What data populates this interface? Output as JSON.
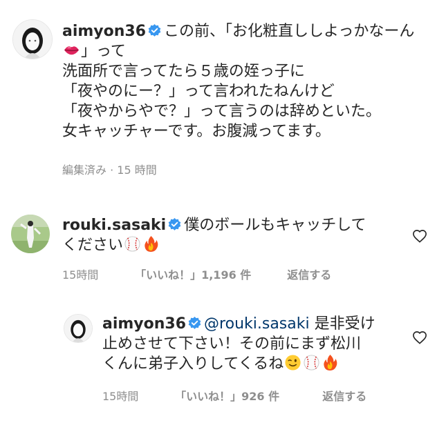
{
  "main_comment": {
    "username": "aimyon36",
    "verified": true,
    "text_line1": "この前、「お化粧直ししよっかなーん",
    "text_line2_suffix": "」って",
    "text_line3": "洗面所で言ってたら５歳の姪っ子に",
    "text_line4": "「夜やのにー？」って言われたねんけど",
    "text_line5": "「夜やからやで？」って言うのは辞めといた。",
    "text_line6": "女キャッチャーです。お腹減ってます。",
    "edited_label": "編集済み",
    "separator": "·",
    "timestamp": "15 時間"
  },
  "reply_1": {
    "username": "rouki.sasaki",
    "verified": true,
    "text_line1": "僕のボールもキャッチして",
    "text_line2": "ください",
    "timestamp": "15時間",
    "likes_label": "「いいね！」1,196 件",
    "reply_label": "返信する"
  },
  "reply_2": {
    "username": "aimyon36",
    "verified": true,
    "mention": "@rouki.sasaki",
    "text_line1_suffix": "是非受け",
    "text_line2": "止めさせて下さい！その前にまず松川",
    "text_line3": "くんに弟子入りしてくるね",
    "timestamp": "15時間",
    "likes_label": "「いいね！」926 件",
    "reply_label": "返信する"
  },
  "icons": {
    "verified": "verified-badge-icon",
    "heart": "heart-outline-icon",
    "lips": "lips-emoji",
    "baseball": "baseball-emoji",
    "fire": "fire-emoji",
    "wink": "winking-face-emoji"
  },
  "colors": {
    "text": "#262626",
    "secondary": "#8e8e8e",
    "verified_blue": "#3897f0",
    "mention": "#00376b"
  }
}
